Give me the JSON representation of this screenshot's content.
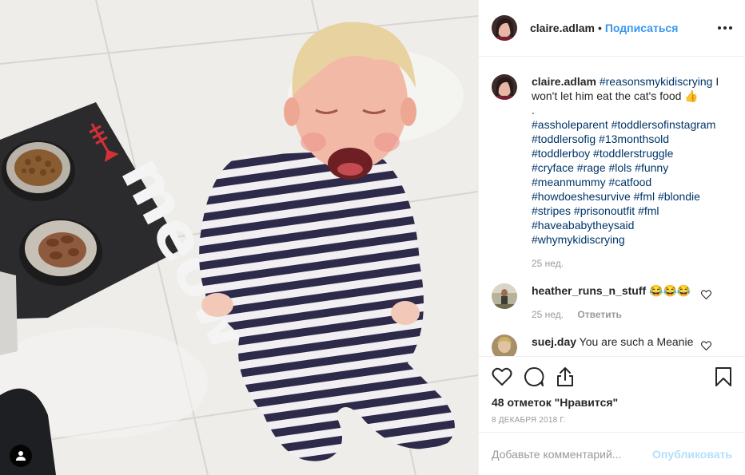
{
  "post": {
    "author": "claire.adlam",
    "follow_label": "Подписаться",
    "separator": "•",
    "more_icon": "more-horizontal-icon"
  },
  "caption": {
    "username": "claire.adlam",
    "first_tag": "#reasonsmykidiscrying",
    "text": " I won't let him eat the cat's food 👍",
    "dot": ".",
    "hashtag_lines": [
      "#assholeparent #toddlersofinstagram",
      "#toddlersofig #13monthsold",
      "#toddlerboy #toddlerstruggle",
      "#cryface #rage #lols #funny",
      "#meanmummy #catfood",
      "#howdoeshesurvive #fml #blondie",
      "#stripes #prisonoutfit #fml",
      "#haveababytheysaid",
      "#whymykidiscrying"
    ],
    "time": "25 нед."
  },
  "comments": [
    {
      "username": "heather_runs_n_stuff",
      "text": " 😂😂😂",
      "time": "25 нед.",
      "reply_label": "Ответить"
    },
    {
      "username": "suej.day",
      "text": " You are such a Meanie"
    }
  ],
  "actions": {
    "like_icon": "heart-icon",
    "comment_icon": "comment-bubble-icon",
    "share_icon": "share-icon",
    "save_icon": "bookmark-icon"
  },
  "likes_text": "48 отметок \"Нравится\"",
  "date": "8 ДЕКАБРЯ 2018 Г.",
  "comment_form": {
    "placeholder": "Добавьте комментарий...",
    "publish_label": "Опубликовать"
  },
  "photo": {
    "user_tag_icon": "user-tag-icon",
    "mat_text": "meow"
  }
}
